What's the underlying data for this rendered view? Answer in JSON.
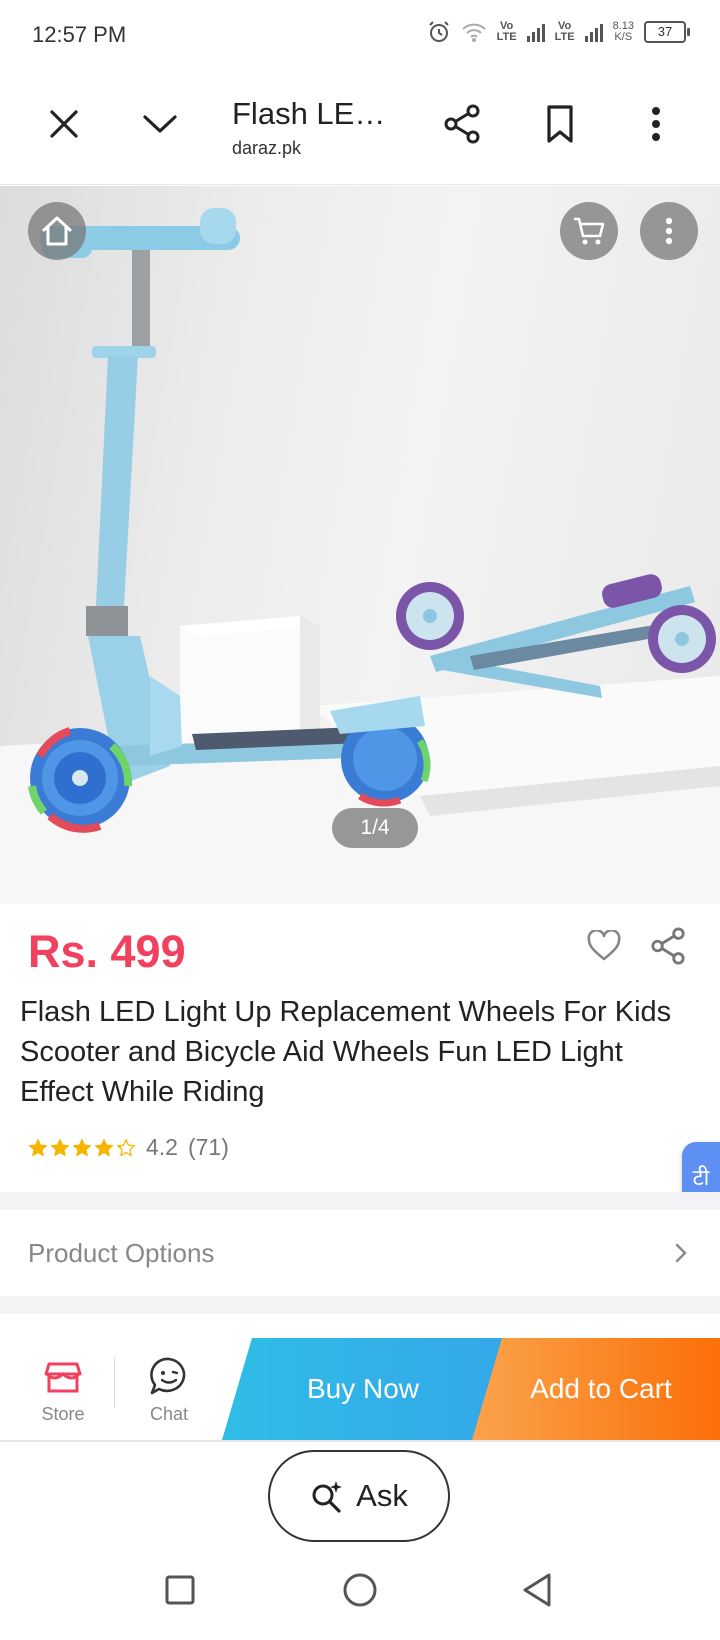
{
  "status_bar": {
    "time": "12:57 PM",
    "net1": "Vo\nLTE",
    "net2": "Vo\nLTE",
    "speed": "8.13\nK/S",
    "battery": "37"
  },
  "browser": {
    "title": "Flash LE…",
    "domain": "daraz.pk"
  },
  "hero": {
    "counter": "1/4"
  },
  "product": {
    "price": "Rs. 499",
    "title": "Flash LED Light Up Replacement Wheels For Kids Scooter and Bicycle Aid Wheels Fun LED Light Effect While Riding",
    "rating_value": "4.2",
    "rating_count": "(71)",
    "rating_stars": 4.2
  },
  "options": {
    "label": "Product Options"
  },
  "actions": {
    "store_label": "Store",
    "chat_label": "Chat",
    "buy_now": "Buy Now",
    "add_to_cart": "Add to Cart"
  },
  "ask": {
    "label": "Ask"
  },
  "floating_badge": {
    "glyph": "टी"
  },
  "colors": {
    "price": "#f2405f",
    "buy_now": "#34a7e8",
    "add_to_cart": "#fb6f07",
    "star": "#f7b500"
  }
}
